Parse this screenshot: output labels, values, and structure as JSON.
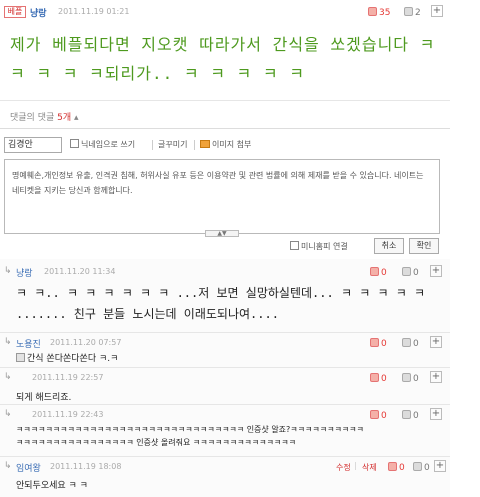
{
  "post": {
    "badge": "베플",
    "author": "냥랑",
    "date": "2011.11.19 01:21",
    "upvotes": "35",
    "downvotes": "2",
    "text": "제가 베플되다면 지오캣 따라가서 간식을 쏘겠습니다 ㅋ ㅋ ㅋ ㅋ ㅋ되리가.. ㅋ ㅋ ㅋ ㅋ ㅋ"
  },
  "comment_count": {
    "label": "댓글의 댓글",
    "count": "5개"
  },
  "composer": {
    "name_value": "김경안",
    "nickname_label": "닉네임으로 쓰기",
    "emoticon_label": "글꾸미기",
    "image_label": "이미지 첨부",
    "notice": "명예훼손,개인정보 유출, 인격권 침해, 허위사실 유포 등은 이용약관 및 관련 법률에 의해 제재를 받을 수 있습니다. 네이트는 네티켓을 지키는 당신과 함께합니다.",
    "minihompi_label": "미니홈피 연결",
    "cancel_label": "취소",
    "confirm_label": "확인"
  },
  "replies": [
    {
      "author": "냥랑",
      "date": "2011.11.20 11:34",
      "upvotes": "0",
      "downvotes": "0",
      "text": "ㅋ ㅋ.. ㅋ ㅋ ㅋ ㅋ ㅋ ㅋ ...저 보면 실망하실텐데... ㅋ ㅋ ㅋ ㅋ ㅋ ....... 친구 분들 노시는데 이래도되나여...."
    },
    {
      "author": "노용진",
      "date": "2011.11.20 07:57",
      "upvotes": "0",
      "downvotes": "0",
      "text": "간식 쏜다쏜다쏜다 ㅋ.ㅋ"
    },
    {
      "author": "",
      "date": "2011.11.19 22:57",
      "upvotes": "0",
      "downvotes": "0",
      "text": "되게 해드리죠."
    },
    {
      "author": "",
      "date": "2011.11.19 22:43",
      "upvotes": "0",
      "downvotes": "0",
      "line1": "ㅋㅋㅋㅋㅋㅋㅋㅋㅋㅋㅋㅋㅋㅋㅋㅋㅋㅋㅋㅋㅋㅋㅋㅋㅋㅋㅋㅋㅋㅋㅋ 인증샷 알죠?ㅋㅋㅋㅋㅋㅋㅋㅋㅋㅋ",
      "line2": "ㅋㅋㅋㅋㅋㅋㅋㅋㅋㅋㅋㅋㅋㅋㅋㅋ 인증샷 올려줘요 ㅋㅋㅋㅋㅋㅋㅋㅋㅋㅋㅋㅋㅋㅋ"
    },
    {
      "author": "임여왕",
      "date": "2011.11.19 18:08",
      "upvotes": "0",
      "downvotes": "0",
      "edit_label": "수정",
      "delete_label": "삭제",
      "text": "안되두오세요 ㅋ ㅋ"
    }
  ],
  "colors": {
    "accent": "#d32f2f",
    "author": "#3a6db5",
    "handwriting": "#4e9a1f"
  }
}
